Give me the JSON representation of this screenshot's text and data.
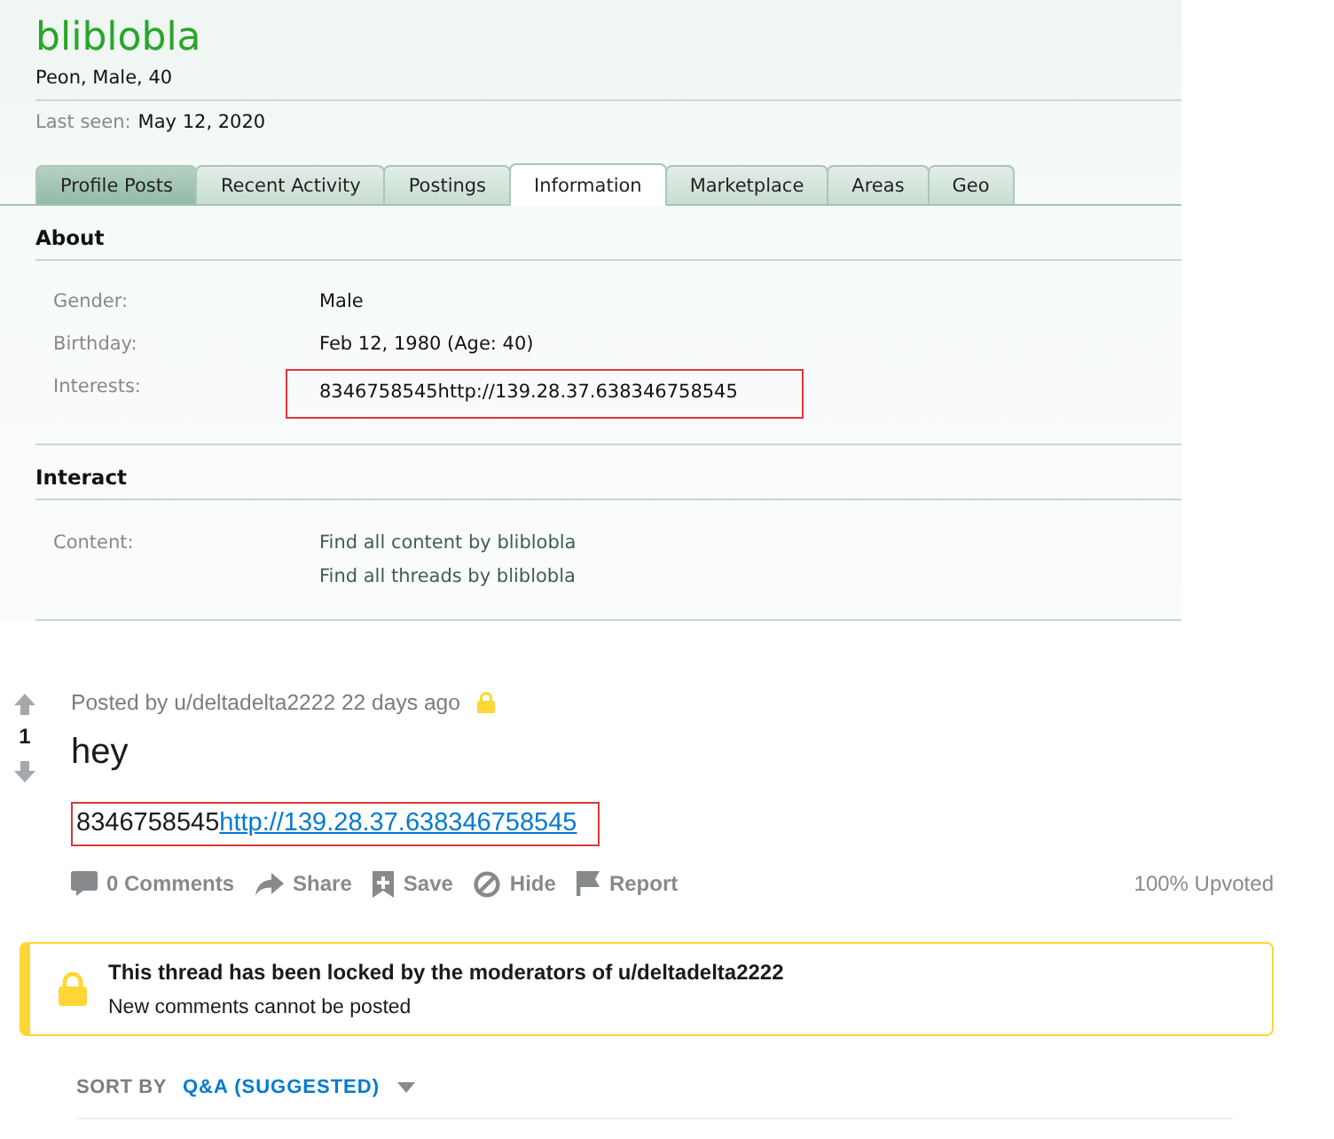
{
  "profile": {
    "username": "bliblobla",
    "subtitle": "Peon, Male, 40",
    "last_seen_label": "Last seen:",
    "last_seen_value": "May 12, 2020"
  },
  "tabs": [
    {
      "label": "Profile Posts",
      "selected": false,
      "hovered": true
    },
    {
      "label": "Recent Activity",
      "selected": false,
      "hovered": false
    },
    {
      "label": "Postings",
      "selected": false,
      "hovered": false
    },
    {
      "label": "Information",
      "selected": true,
      "hovered": false
    },
    {
      "label": "Marketplace",
      "selected": false,
      "hovered": false
    },
    {
      "label": "Areas",
      "selected": false,
      "hovered": false
    },
    {
      "label": "Geo",
      "selected": false,
      "hovered": false
    }
  ],
  "about": {
    "heading": "About",
    "rows": [
      {
        "label": "Gender:",
        "value": "Male",
        "highlighted": false
      },
      {
        "label": "Birthday:",
        "value": "Feb 12, 1980 (Age: 40)",
        "highlighted": false
      },
      {
        "label": "Interests:",
        "value": "8346758545http://139.28.37.638346758545",
        "highlighted": true
      }
    ]
  },
  "interact": {
    "heading": "Interact",
    "rows": [
      {
        "label": "Content:",
        "links": [
          "Find all content by bliblobla",
          "Find all threads by bliblobla"
        ]
      }
    ]
  },
  "post": {
    "score": "1",
    "byline": "Posted by u/deltadelta2222 22 days ago",
    "locked": true,
    "title": "hey",
    "body_text": "8346758545",
    "body_link": "http://139.28.37.638346758545",
    "highlighted": true,
    "actions": [
      {
        "kind": "comments",
        "label": "0 Comments"
      },
      {
        "kind": "share",
        "label": "Share"
      },
      {
        "kind": "save",
        "label": "Save"
      },
      {
        "kind": "hide",
        "label": "Hide"
      },
      {
        "kind": "report",
        "label": "Report"
      }
    ],
    "upvoted": "100% Upvoted"
  },
  "lock_notice": {
    "title": "This thread has been locked by the moderators of u/deltadelta2222",
    "subtitle": "New comments cannot be posted"
  },
  "sort": {
    "label": "SORT BY",
    "value": "Q&A (SUGGESTED)"
  }
}
